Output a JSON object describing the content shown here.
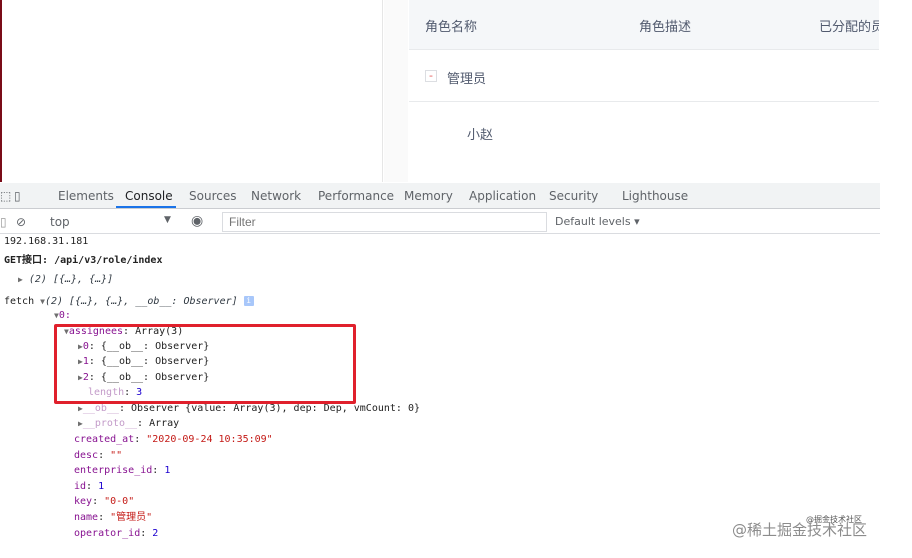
{
  "role_table": {
    "columns": [
      "角色名称",
      "角色描述",
      "已分配的员"
    ],
    "rows": [
      {
        "toggle": "-",
        "name": "管理员"
      },
      {
        "name": "小赵"
      }
    ]
  },
  "devtools": {
    "tabs": [
      "Elements",
      "Console",
      "Sources",
      "Network",
      "Performance",
      "Memory",
      "Application",
      "Security",
      "Lighthouse"
    ],
    "active_tab": "Console",
    "context": "top",
    "filter_placeholder": "Filter",
    "levels": "Default levels ▾"
  },
  "console": {
    "ip": "192.168.31.181",
    "get_label": "GET接口: /api/v3/role/index",
    "array_summary": "(2) [{…}, {…}]",
    "fetch_label": "fetch",
    "fetch_summary": "(2) [{…}, {…}, __ob__: Observer]",
    "item0": "0:",
    "assignees": {
      "key": "assignees",
      "value": "Array(3)"
    },
    "assignee_items": [
      {
        "key": "0",
        "value": "{__ob__: Observer}"
      },
      {
        "key": "1",
        "value": "{__ob__: Observer}"
      },
      {
        "key": "2",
        "value": "{__ob__: Observer}"
      }
    ],
    "length": {
      "key": "length",
      "value": "3"
    },
    "ob": {
      "key": "__ob__",
      "value": "Observer {value: Array(3), dep: Dep, vmCount: 0}"
    },
    "proto": {
      "key": "__proto__",
      "value": "Array"
    },
    "fields": [
      {
        "key": "created_at",
        "value": "\"2020-09-24 10:35:09\"",
        "kind": "str"
      },
      {
        "key": "desc",
        "value": "\"\"",
        "kind": "str"
      },
      {
        "key": "enterprise_id",
        "value": "1",
        "kind": "num"
      },
      {
        "key": "id",
        "value": "1",
        "kind": "num"
      },
      {
        "key": "key",
        "value": "\"0-0\"",
        "kind": "str"
      },
      {
        "key": "name",
        "value": "\"管理员\"",
        "kind": "str"
      },
      {
        "key": "operator_id",
        "value": "2",
        "kind": "num"
      }
    ]
  },
  "watermark": "@稀土掘金技术社区",
  "watermark_small": "@掘金技术社区",
  "colors": {
    "highlight": "#e0202c",
    "key": "#881391",
    "string": "#c41a16",
    "number": "#1c00cf",
    "active_tab": "#1a73e8"
  }
}
